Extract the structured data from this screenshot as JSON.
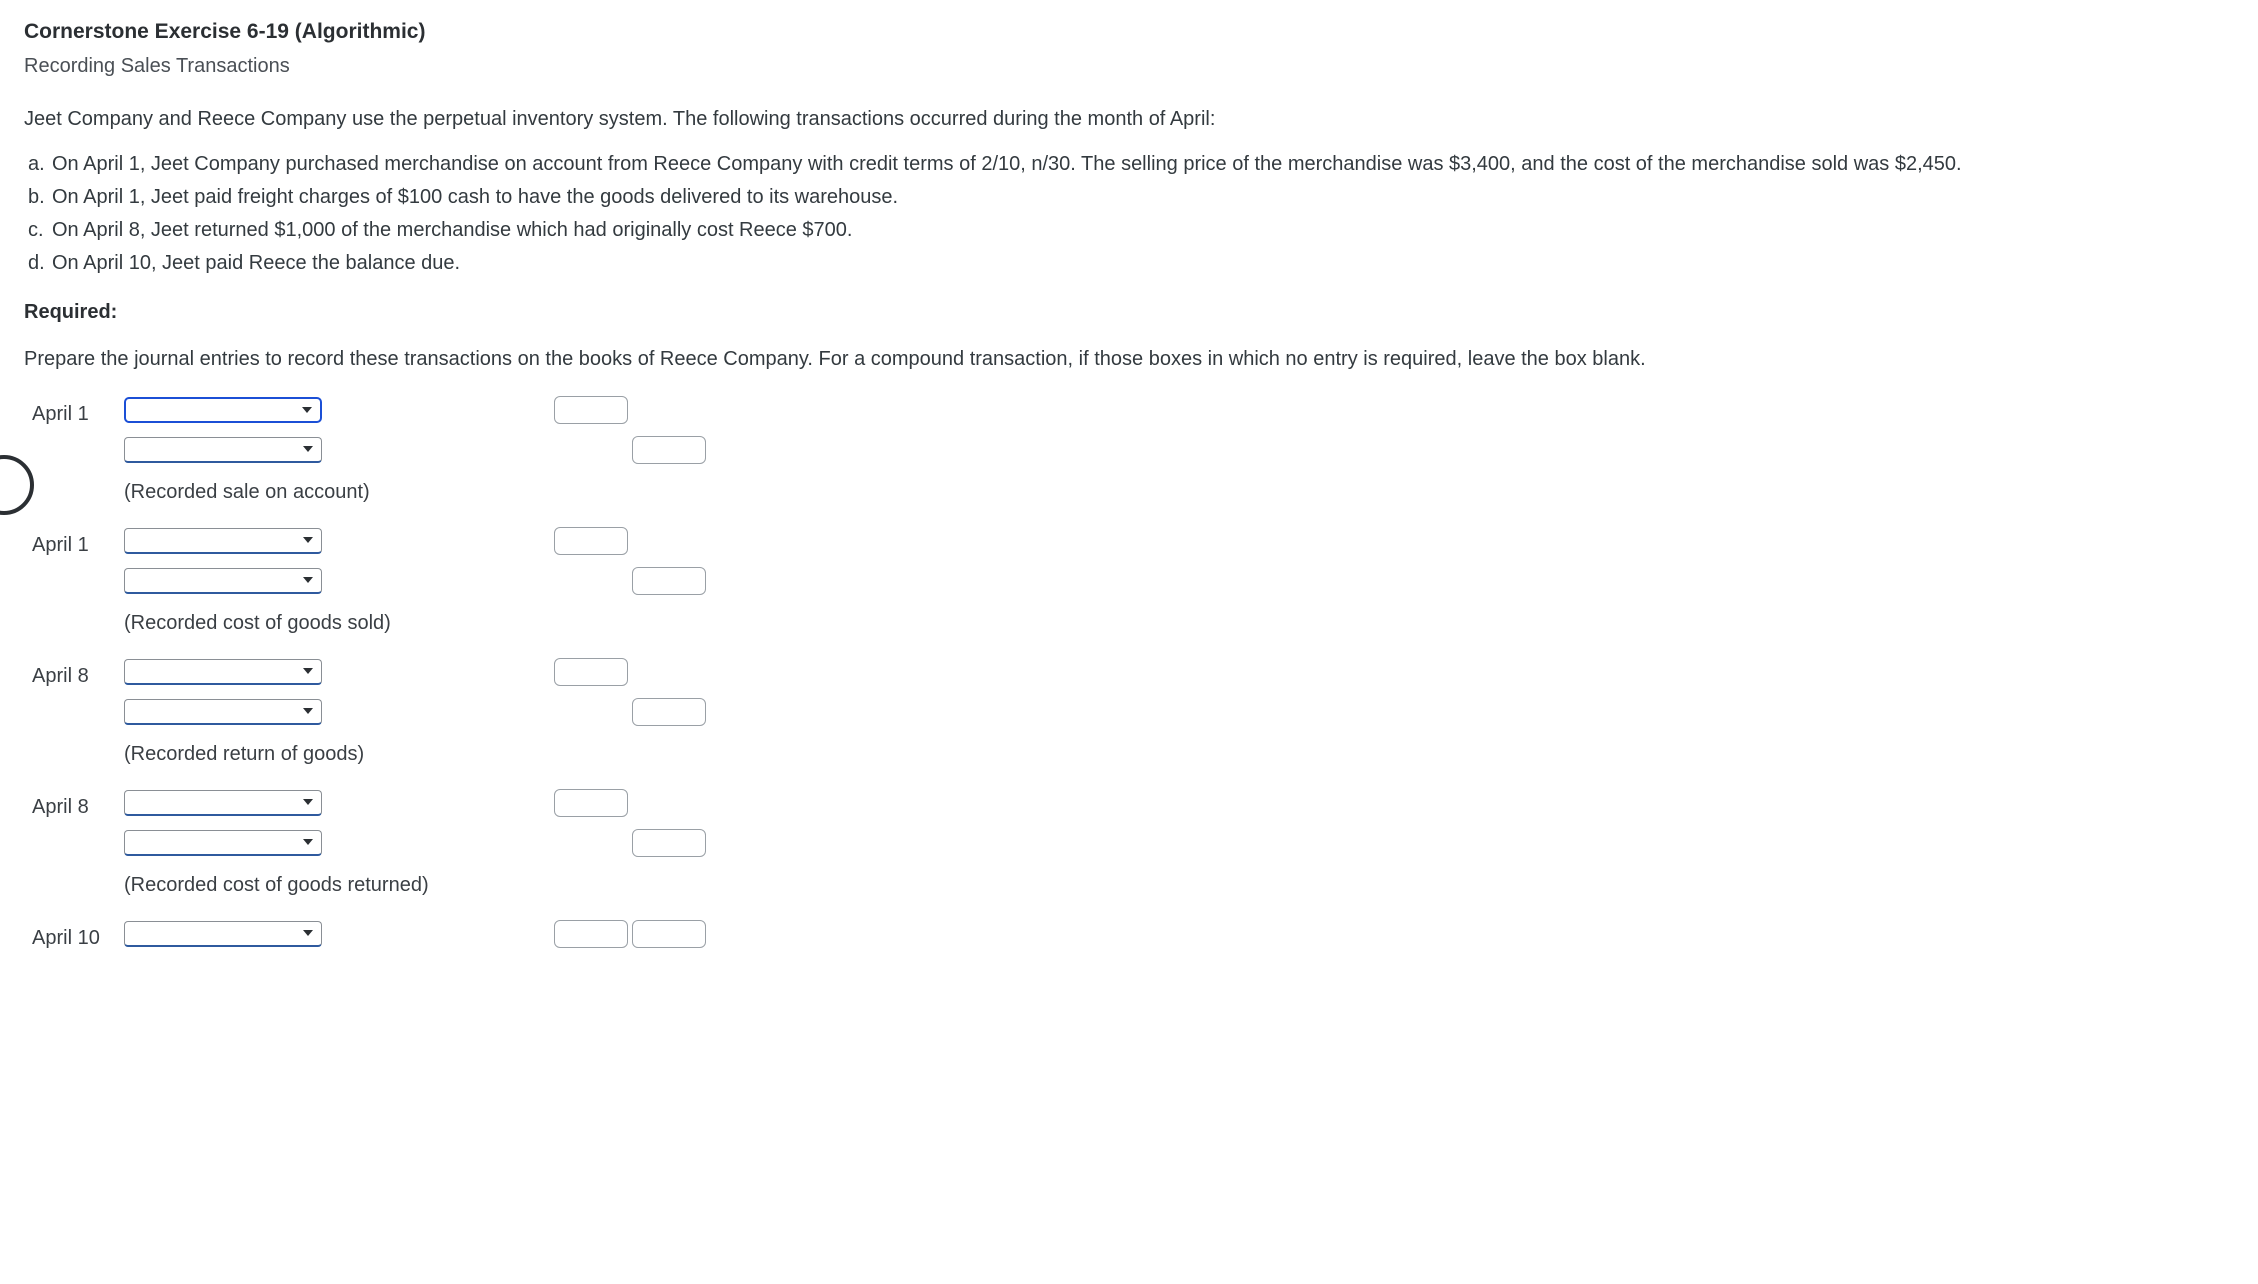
{
  "header": {
    "title": "Cornerstone Exercise 6-19 (Algorithmic)",
    "subtitle": "Recording Sales Transactions"
  },
  "intro": "Jeet Company and Reece Company use the perpetual inventory system. The following transactions occurred during the month of April:",
  "items": [
    {
      "label": "a.",
      "text": "On April 1, Jeet Company purchased merchandise on account from Reece Company with credit terms of 2/10, n/30. The selling price of the merchandise was $3,400, and the cost of the merchandise sold was $2,450."
    },
    {
      "label": "b.",
      "text": "On April 1, Jeet paid freight charges of $100 cash to have the goods delivered to its warehouse."
    },
    {
      "label": "c.",
      "text": "On April 8, Jeet returned $1,000 of the merchandise which had originally cost Reece $700."
    },
    {
      "label": "d.",
      "text": "On April 10, Jeet paid Reece the balance due."
    }
  ],
  "required_label": "Required:",
  "instructions": "Prepare the journal entries to record these transactions on the books of Reece Company. For a compound transaction, if those boxes in which no entry is required, leave the box blank.",
  "entries": [
    {
      "date": "April 1",
      "memo": "(Recorded sale on account)",
      "focused": true
    },
    {
      "date": "April 1",
      "memo": "(Recorded cost of goods sold)",
      "focused": false
    },
    {
      "date": "April 8",
      "memo": "(Recorded return of goods)",
      "focused": false
    },
    {
      "date": "April 8",
      "memo": "(Recorded cost of goods returned)",
      "focused": false
    },
    {
      "date": "April 10",
      "memo": "",
      "focused": false
    }
  ]
}
